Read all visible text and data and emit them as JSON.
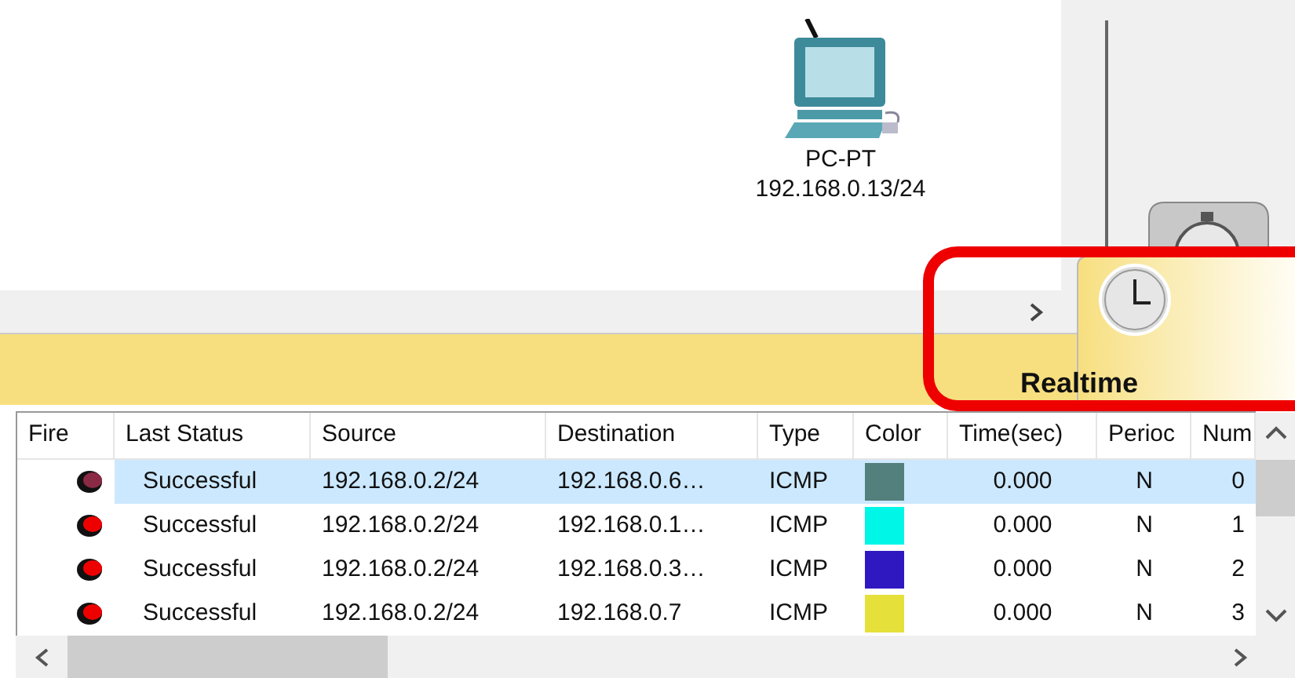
{
  "device": {
    "name": "PC-PT",
    "address": "192.168.0.13/24"
  },
  "mode_tab": {
    "label": "Realtime",
    "selected": true
  },
  "table": {
    "columns": [
      "Fire",
      "Last Status",
      "Source",
      "Destination",
      "Type",
      "Color",
      "Time(sec)",
      "Perioc",
      "Num"
    ],
    "rows": [
      {
        "selected": true,
        "status": "Successful",
        "source": "192.168.0.2/24",
        "destination": "192.168.0.6…",
        "type": "ICMP",
        "color": "#537f7c",
        "time": "0.000",
        "periodic": "N",
        "num": "0"
      },
      {
        "selected": false,
        "status": "Successful",
        "source": "192.168.0.2/24",
        "destination": "192.168.0.1…",
        "type": "ICMP",
        "color": "#00f7e8",
        "time": "0.000",
        "periodic": "N",
        "num": "1"
      },
      {
        "selected": false,
        "status": "Successful",
        "source": "192.168.0.2/24",
        "destination": "192.168.0.3…",
        "type": "ICMP",
        "color": "#3018c0",
        "time": "0.000",
        "periodic": "N",
        "num": "2"
      },
      {
        "selected": false,
        "status": "Successful",
        "source": "192.168.0.2/24",
        "destination": "192.168.0.7",
        "type": "ICMP",
        "color": "#e6e03a",
        "time": "0.000",
        "periodic": "N",
        "num": "3"
      }
    ]
  }
}
